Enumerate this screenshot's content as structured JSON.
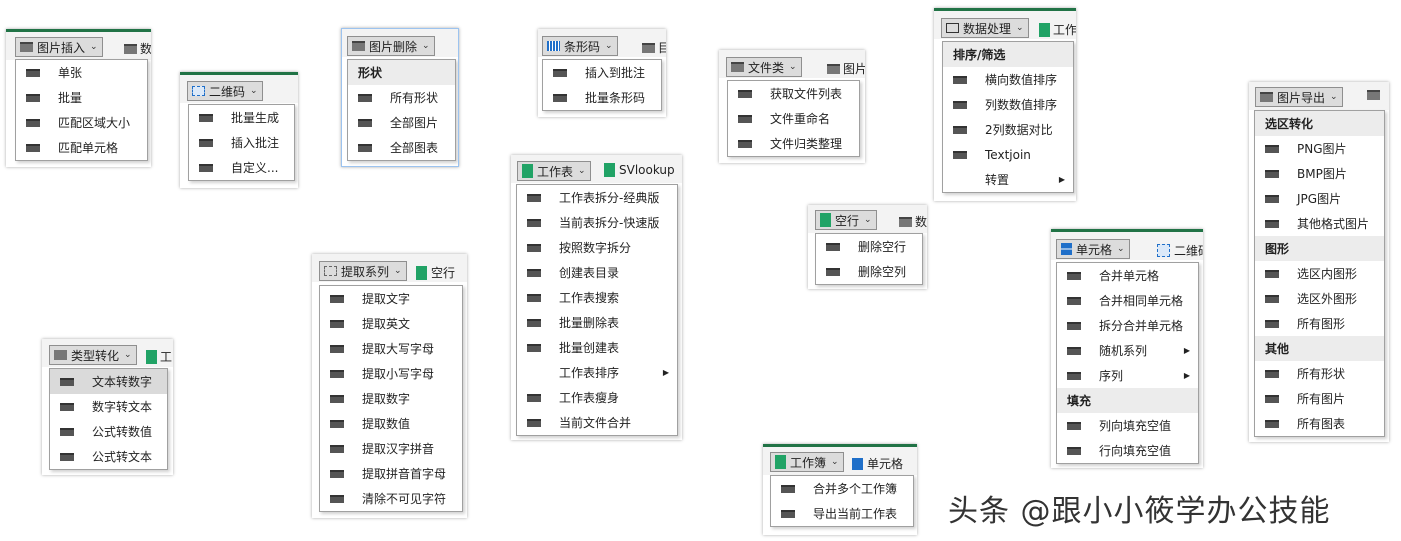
{
  "picture_insert": {
    "button": "图片插入",
    "ghost": "数",
    "items": [
      "单张",
      "批量",
      "匹配区域大小",
      "匹配单元格"
    ]
  },
  "qrcode": {
    "button": "二维码",
    "items": [
      "批量生成",
      "插入批注",
      "自定义..."
    ]
  },
  "picture_delete": {
    "button": "图片删除",
    "section": "形状",
    "items": [
      "所有形状",
      "全部图片",
      "全部图表"
    ]
  },
  "barcode": {
    "button": "条形码",
    "ghost": "目",
    "items": [
      "插入到批注",
      "批量条形码"
    ]
  },
  "file_type": {
    "button": "文件类",
    "ghost": "图片",
    "items": [
      "获取文件列表",
      "文件重命名",
      "文件归类整理"
    ]
  },
  "data_process": {
    "button": "数据处理",
    "ghost": "工作",
    "section": "排序/筛选",
    "items": [
      "横向数值排序",
      "列数数值排序",
      "2列数据对比",
      "Textjoin",
      "转置"
    ]
  },
  "picture_export": {
    "button": "图片导出",
    "sections": [
      {
        "title": "选区转化",
        "items": [
          "PNG图片",
          "BMP图片",
          "JPG图片",
          "其他格式图片"
        ]
      },
      {
        "title": "图形",
        "items": [
          "选区内图形",
          "选区外图形",
          "所有图形"
        ]
      },
      {
        "title": "其他",
        "items": [
          "所有形状",
          "所有图片",
          "所有图表"
        ]
      }
    ]
  },
  "worksheet": {
    "button": "工作表",
    "ghost": "SVlookup",
    "items": [
      "工作表拆分-经典版",
      "当前表拆分-快速版",
      "按照数字拆分",
      "创建表目录",
      "工作表搜索",
      "批量删除表",
      "批量创建表",
      "工作表排序",
      "工作表瘦身",
      "当前文件合并"
    ]
  },
  "empty_row": {
    "button": "空行",
    "ghost": "数",
    "items": [
      "删除空行",
      "删除空列"
    ]
  },
  "cell": {
    "button": "单元格",
    "ghost": "二维码",
    "items": [
      "合并单元格",
      "合并相同单元格",
      "拆分合并单元格",
      "随机系列",
      "序列"
    ],
    "section": "填充",
    "fill_items": [
      "列向填充空值",
      "行向填充空值"
    ]
  },
  "extract": {
    "button": "提取系列",
    "ghost": "空行",
    "items": [
      "提取文字",
      "提取英文",
      "提取大写字母",
      "提取小写字母",
      "提取数字",
      "提取数值",
      "提取汉字拼音",
      "提取拼音首字母",
      "清除不可见字符"
    ]
  },
  "type_convert": {
    "button": "类型转化",
    "ghost": "工",
    "items": [
      "文本转数字",
      "数字转文本",
      "公式转数值",
      "公式转文本"
    ]
  },
  "workbook": {
    "button": "工作簿",
    "ghost": "单元格",
    "items": [
      "合并多个工作簿",
      "导出当前工作表"
    ]
  },
  "watermark": "头条 @跟小小筱学办公技能"
}
